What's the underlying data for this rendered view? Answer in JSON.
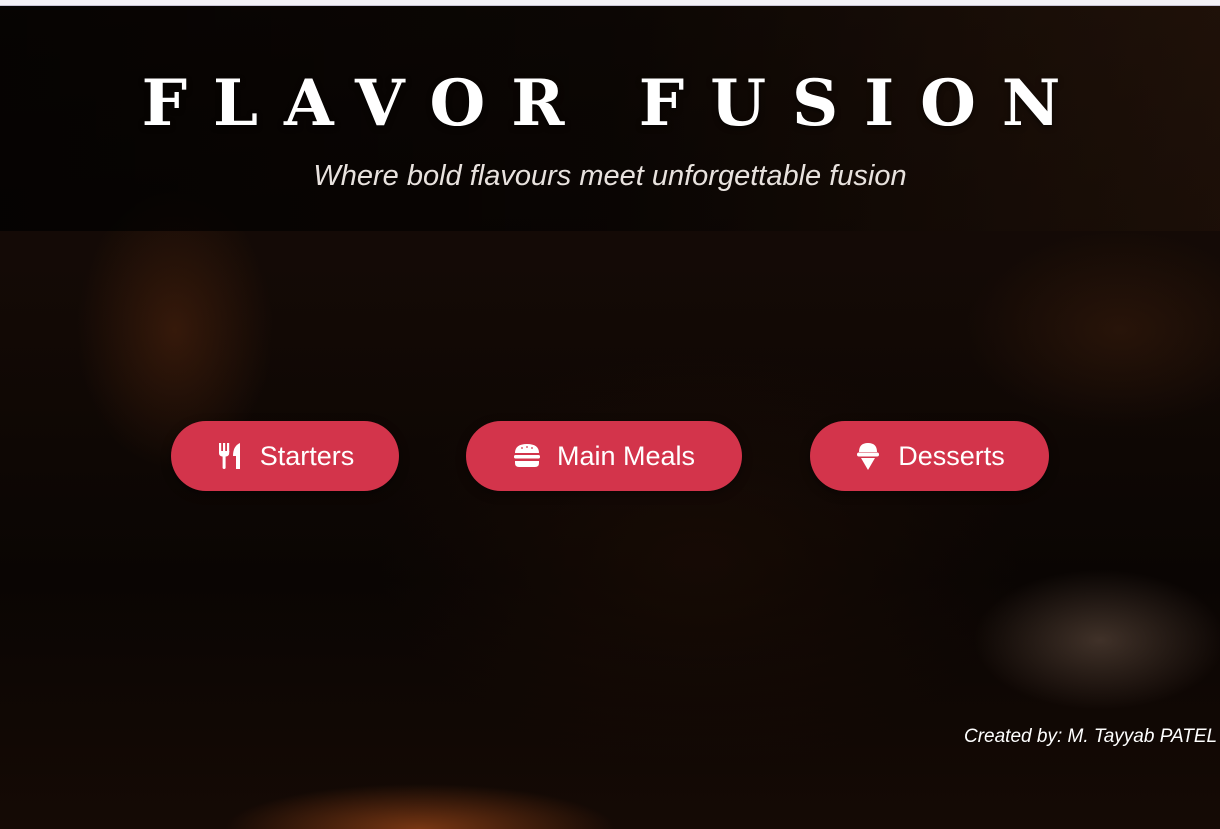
{
  "site": {
    "title": "FLAVOR FUSION",
    "tagline": "Where bold flavours meet unforgettable fusion"
  },
  "menu": {
    "buttons": [
      {
        "label": "Starters",
        "icon": "utensils-icon"
      },
      {
        "label": "Main Meals",
        "icon": "burger-icon"
      },
      {
        "label": "Desserts",
        "icon": "ice-cream-icon"
      }
    ]
  },
  "footer": {
    "credit": "Created by: M. Tayyab PATEL"
  },
  "colors": {
    "button": "#d3344b",
    "text": "#ffffff"
  }
}
